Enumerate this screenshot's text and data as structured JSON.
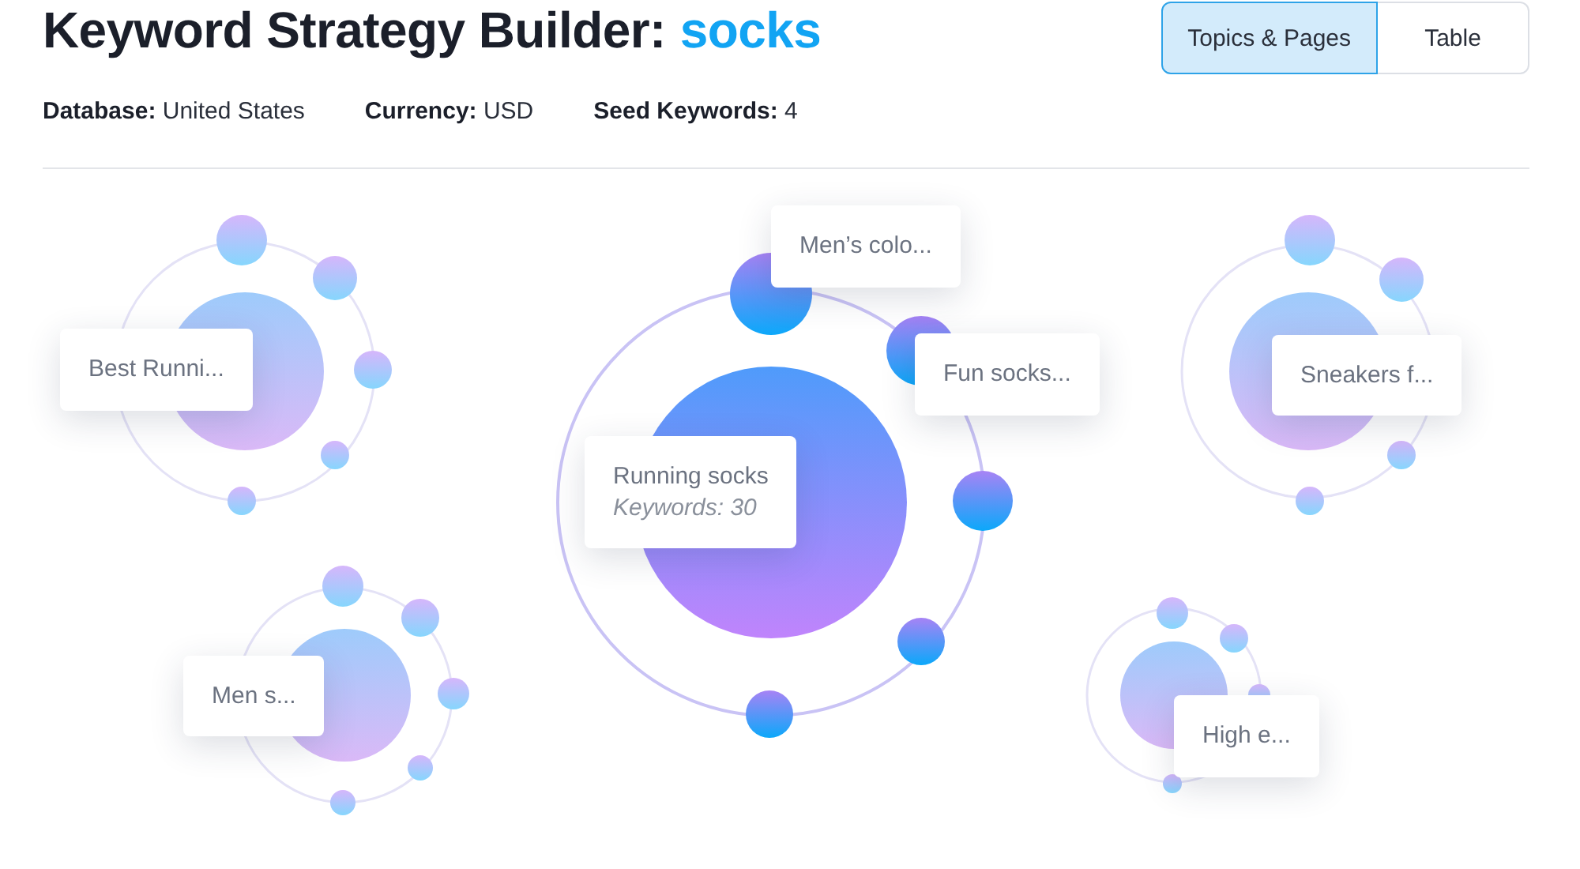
{
  "title": {
    "text": "Keyword Strategy Builder:",
    "keyword": "socks"
  },
  "meta": [
    "**Database:** United States",
    "**Currency:** USD",
    "**Seed Keywords:** 4"
  ],
  "view_tabs": [
    {
      "label": "Topics & Pages",
      "selected": true
    },
    {
      "label": "Table",
      "selected": false
    }
  ],
  "topics": [
    {
      "label": "Best Runni...",
      "selected": false
    },
    {
      "label": "Running socks",
      "detail": "Keywords: 30",
      "selected": true,
      "pages": [
        {
          "label": "Men’s colo..."
        },
        {
          "label": "Fun socks..."
        }
      ]
    },
    {
      "label": "Sneakers f...",
      "selected": false
    },
    {
      "label": "Men s...",
      "selected": false
    },
    {
      "label": "High e...",
      "selected": false
    }
  ]
}
